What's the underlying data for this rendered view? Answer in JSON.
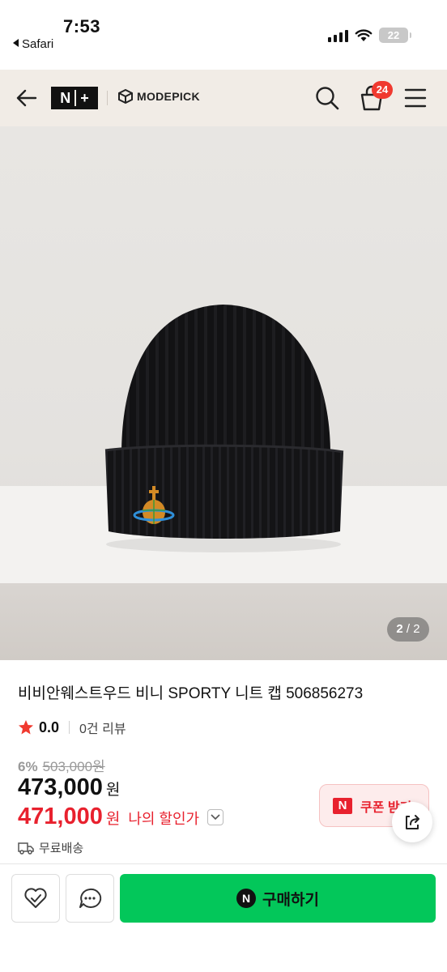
{
  "status_bar": {
    "time": "7:53",
    "back_app": "Safari",
    "battery": "22"
  },
  "header": {
    "logo_n": "N",
    "logo_plus": "+",
    "brand": "MODEPICK",
    "cart_count": "24"
  },
  "gallery": {
    "current": "2",
    "total": "2"
  },
  "product": {
    "title": "비비안웨스트우드 비니 SPORTY 니트 캡 506856273",
    "rating": "0.0",
    "review_count": "0건 리뷰",
    "discount_rate": "6%",
    "original_price": "503,000원",
    "price": "473,000",
    "price_unit": "원",
    "my_price": "471,000",
    "my_price_unit": "원",
    "my_price_label": "나의 할인가",
    "coupon_label": "쿠폰 받기",
    "shipping": "무료배송"
  },
  "bottom_bar": {
    "buy_label": "구매하기"
  },
  "colors": {
    "header_bg": "#f1ece6",
    "accent_red": "#e8212e",
    "buy_green": "#03c75a",
    "star": "#f0392f"
  }
}
